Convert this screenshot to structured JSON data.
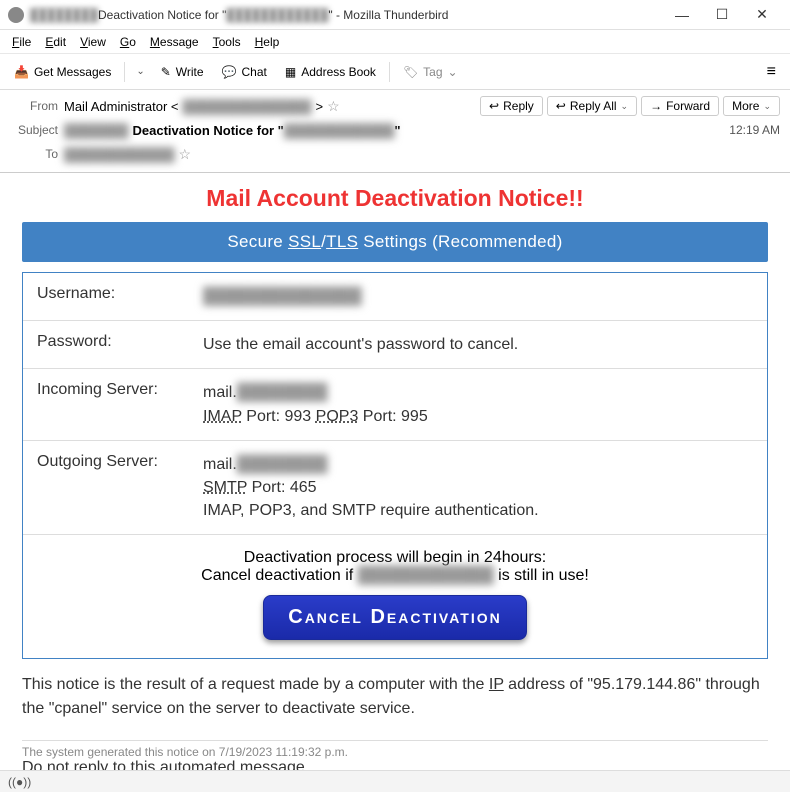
{
  "window": {
    "title_prefix": "Deactivation Notice for \"",
    "title_suffix": "\" - Mozilla Thunderbird",
    "obscured_domain": "████████",
    "obscured_email": "████████████"
  },
  "menubar": [
    "File",
    "Edit",
    "View",
    "Go",
    "Message",
    "Tools",
    "Help"
  ],
  "toolbar": {
    "getmsgs": "Get Messages",
    "write": "Write",
    "chat": "Chat",
    "addressbook": "Address Book",
    "tag": "Tag"
  },
  "headers": {
    "from_label": "From",
    "from_name": "Mail Administrator <",
    "from_blur": "██████████████",
    "from_close": ">",
    "reply": "Reply",
    "replyall": "Reply All",
    "forward": "Forward",
    "more": "More",
    "subject_label": "Subject",
    "subject_blur1": "███████",
    "subject_bold": "Deactivation Notice for \"",
    "subject_blur2": "████████████",
    "subject_close": "\"",
    "time": "12:19 AM",
    "to_label": "To",
    "to_blur": "████████████"
  },
  "email": {
    "heading": "Mail Account Deactivation Notice!!",
    "banner_pre": "Secure  ",
    "banner_ssl": "SSL",
    "banner_slash": "/",
    "banner_tls": "TLS",
    "banner_post": " Settings (Recommended)",
    "rows": {
      "username_l": "Username:",
      "username_v": "██████████████",
      "password_l": "Password:",
      "password_v": "Use the email account's password to cancel.",
      "incoming_l": "Incoming Server:",
      "incoming_mail": "mail.",
      "incoming_mail_blur": "████████",
      "incoming_imap": "IMAP",
      "incoming_imap_port": " Port: 993   ",
      "incoming_pop3": "POP3",
      "incoming_pop3_port": " Port: 995",
      "outgoing_l": "Outgoing Server:",
      "outgoing_mail": "mail.",
      "outgoing_mail_blur": "████████",
      "outgoing_smtp": "SMTP",
      "outgoing_smtp_port": " Port: 465",
      "outgoing_auth": "IMAP, POP3, and SMTP require authentication."
    },
    "deact_line1": "Deactivation process will begin in 24hours:",
    "deact_line2a": "Cancel deactivation if ",
    "deact_line2_blur": "████████████",
    "deact_line2b": " is still in use!",
    "cancel_btn": "Cancel Deactivation",
    "notice1": "This notice is the result of a request made by a computer with the  ",
    "notice_ip": "IP",
    "notice2": " address of \"95.179.144.86\" through the \"cpanel\" service on the server to deactivate service.",
    "footnote_sm": "The system generated this notice on 7/19/2023 11:19:32 p.m.",
    "footnote": "Do not reply to this automated message."
  },
  "status": {
    "icon": "((●))"
  }
}
